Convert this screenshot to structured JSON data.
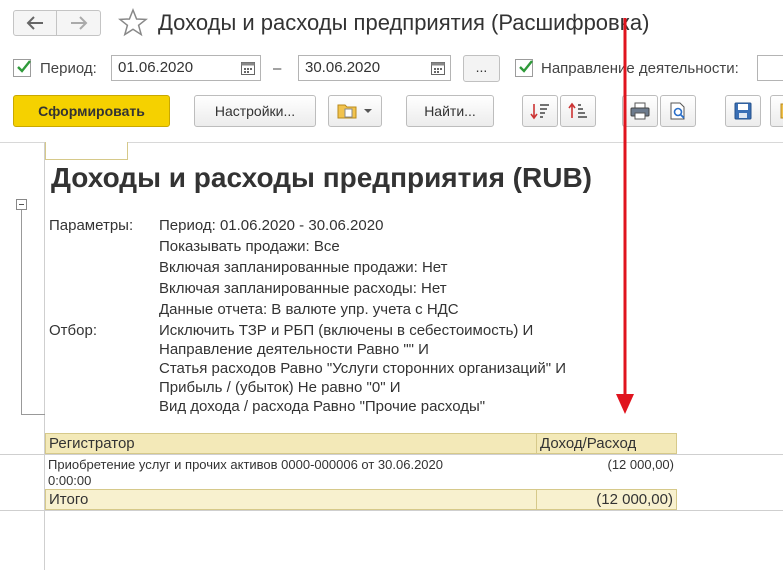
{
  "window": {
    "title": "Доходы и расходы предприятия (Расшифровка)"
  },
  "filters": {
    "period_label": "Период:",
    "period_from": "01.06.2020",
    "period_dash": "–",
    "period_to": "30.06.2020",
    "dots_label": "...",
    "direction_label": "Направление деятельности:",
    "period_checked": true,
    "direction_checked": true
  },
  "toolbar": {
    "generate_label": "Сформировать",
    "settings_label": "Настройки...",
    "find_label": "Найти..."
  },
  "report": {
    "title": "Доходы и расходы предприятия (RUB)",
    "params_label": "Параметры:",
    "params": [
      "Период: 01.06.2020 - 30.06.2020",
      "Показывать продажи: Все",
      "Включая запланированные продажи: Нет",
      "Включая запланированные расходы: Нет",
      "Данные отчета: В валюте упр. учета с НДС"
    ],
    "filter_label": "Отбор:",
    "filters": [
      "Исключить ТЗР и РБП (включены в себестоимость) И",
      "Направление деятельности Равно \"\" И",
      "Статья расходов Равно \"Услуги сторонних организаций\" И",
      "Прибыль / (убыток) Не равно \"0\" И",
      "Вид дохода / расхода Равно \"Прочие расходы\""
    ],
    "table": {
      "columns": [
        "Регистратор",
        "Доход/Расход"
      ],
      "rows": [
        {
          "registrar_line1": "Приобретение услуг и прочих активов 0000-000006 от 30.06.2020",
          "registrar_line2": "0:00:00",
          "amount": "(12 000,00)"
        }
      ],
      "total_label": "Итого",
      "total_amount": "(12 000,00)"
    }
  },
  "colors": {
    "accent_button": "#f5d100",
    "table_header": "#f3e9b8",
    "check_green": "#2f9a3a",
    "annotation_arrow": "#e0141e"
  }
}
